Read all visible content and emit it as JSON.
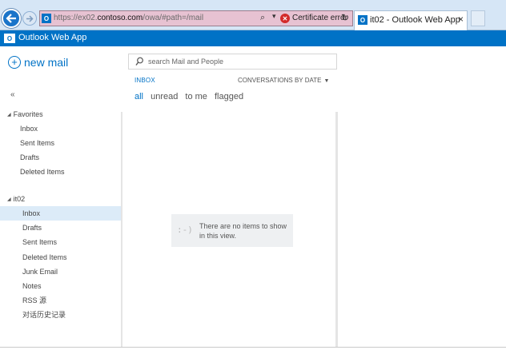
{
  "browser": {
    "url_prefix": "https://ex02.",
    "url_host": "contoso.com",
    "url_path": "/owa/#path=/mail",
    "cert_error_label": "Certificate error",
    "tab_title": "it02 - Outlook Web App",
    "tab_close": "×"
  },
  "owa": {
    "app_title": "Outlook Web App"
  },
  "left_pane": {
    "new_mail_label": "new mail",
    "collapse_label": "«",
    "favorites": {
      "label": "Favorites",
      "items": [
        "Inbox",
        "Sent Items",
        "Drafts",
        "Deleted Items"
      ]
    },
    "mailbox": {
      "label": "it02",
      "selected": "Inbox",
      "items": [
        "Inbox",
        "Drafts",
        "Sent Items",
        "Deleted Items",
        "Junk Email",
        "Notes",
        "RSS 源",
        "对话历史记录"
      ]
    }
  },
  "middle_pane": {
    "search_placeholder": "search Mail and People",
    "folder_title": "INBOX",
    "sort_label": "CONVERSATIONS BY DATE",
    "filters": [
      "all",
      "unread",
      "to me",
      "flagged"
    ],
    "active_filter": "all",
    "empty_face": ":-)",
    "empty_message": "There are no items to show in this view."
  },
  "colors": {
    "accent": "#0072c6",
    "selected_bg": "#dcebf8",
    "address_bar_error": "#e7c2d2"
  }
}
